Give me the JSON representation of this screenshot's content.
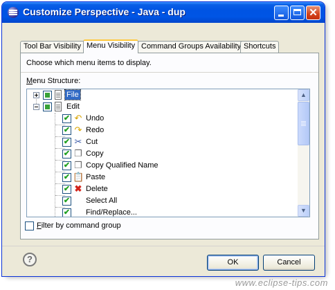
{
  "window": {
    "title": "Customize Perspective - Java - dup"
  },
  "tabs": [
    {
      "label": "Tool Bar Visibility"
    },
    {
      "label": "Menu Visibility"
    },
    {
      "label": "Command Groups Availability"
    },
    {
      "label": "Shortcuts"
    }
  ],
  "active_tab": "Menu Visibility",
  "panel": {
    "description": "Choose which menu items to display.",
    "section_mnemonic": "M",
    "section_rest": "enu Structure:"
  },
  "tree": {
    "items": [
      {
        "label": "File",
        "check": "partial",
        "icon": "document-icon",
        "expander": "plus",
        "selected": true
      },
      {
        "label": "Edit",
        "check": "partial",
        "icon": "document-icon",
        "expander": "minus"
      },
      {
        "label": "Undo",
        "check": "checked",
        "icon": "undo-icon"
      },
      {
        "label": "Redo",
        "check": "checked",
        "icon": "redo-icon"
      },
      {
        "label": "Cut",
        "check": "checked",
        "icon": "cut-icon"
      },
      {
        "label": "Copy",
        "check": "checked",
        "icon": "copy-icon"
      },
      {
        "label": "Copy Qualified Name",
        "check": "checked",
        "icon": "copy-qualified-name-icon"
      },
      {
        "label": "Paste",
        "check": "checked",
        "icon": "paste-icon"
      },
      {
        "label": "Delete",
        "check": "checked",
        "icon": "delete-icon"
      },
      {
        "label": "Select All",
        "check": "checked"
      },
      {
        "label": "Find/Replace...",
        "check": "checked"
      }
    ]
  },
  "filter": {
    "mnemonic": "F",
    "rest": "ilter by command group"
  },
  "buttons": {
    "ok": "OK",
    "cancel": "Cancel",
    "help": "?"
  },
  "watermark": "www.eclipse-tips.com"
}
